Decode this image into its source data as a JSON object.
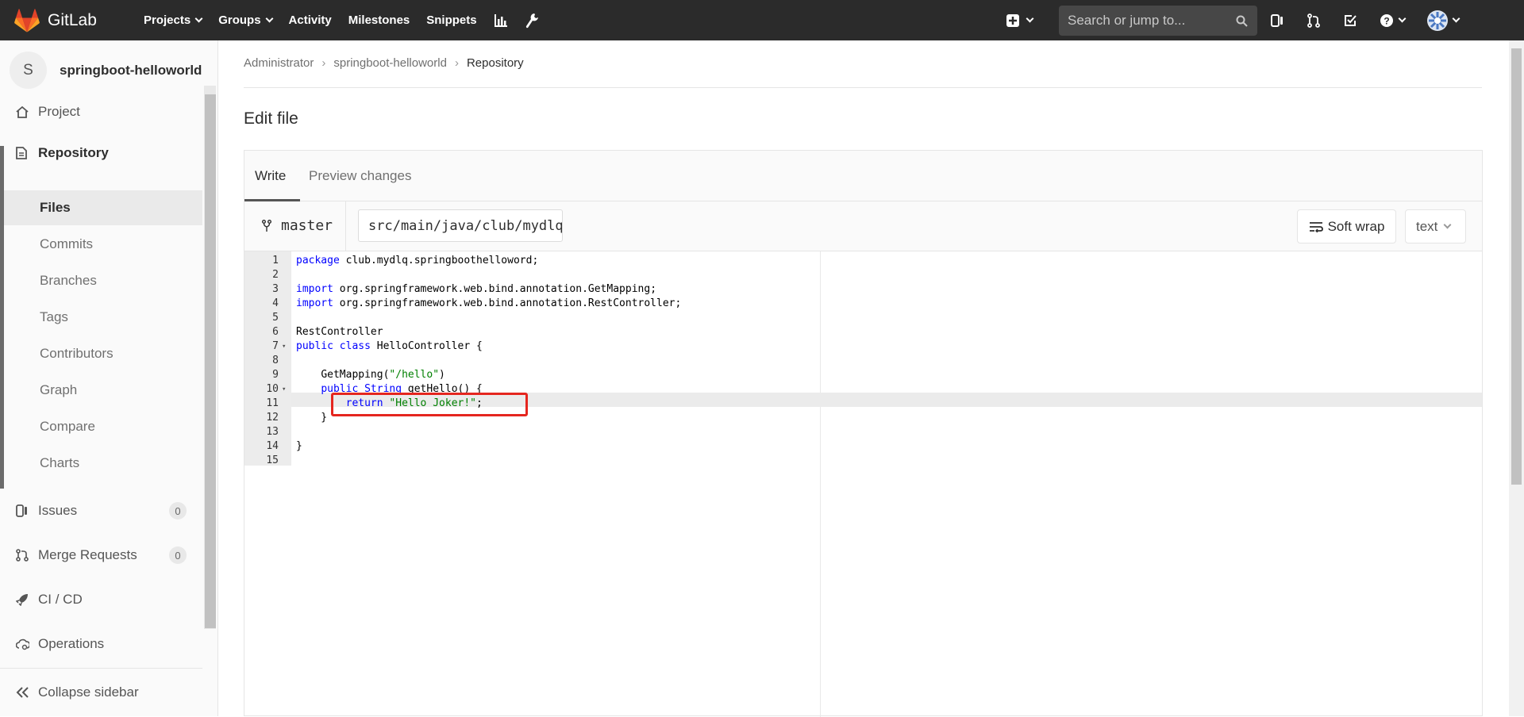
{
  "navbar": {
    "brand": "GitLab",
    "links": [
      {
        "label": "Projects",
        "dropdown": true
      },
      {
        "label": "Groups",
        "dropdown": true
      },
      {
        "label": "Activity",
        "dropdown": false
      },
      {
        "label": "Milestones",
        "dropdown": false
      },
      {
        "label": "Snippets",
        "dropdown": false
      }
    ],
    "search_placeholder": "Search or jump to..."
  },
  "sidebar": {
    "project_avatar": "S",
    "project_name": "springboot-helloworld",
    "items": [
      {
        "label": "Project",
        "icon": "home-icon"
      },
      {
        "label": "Repository",
        "icon": "document-icon"
      },
      {
        "label": "Issues",
        "icon": "issues-icon",
        "count": "0"
      },
      {
        "label": "Merge Requests",
        "icon": "merge-request-icon",
        "count": "0"
      },
      {
        "label": "CI / CD",
        "icon": "rocket-icon"
      },
      {
        "label": "Operations",
        "icon": "cloud-gear-icon"
      }
    ],
    "repository_subitems": [
      "Files",
      "Commits",
      "Branches",
      "Tags",
      "Contributors",
      "Graph",
      "Compare",
      "Charts"
    ],
    "collapse_label": "Collapse sidebar"
  },
  "breadcrumb": {
    "items": [
      "Administrator",
      "springboot-helloworld",
      "Repository"
    ]
  },
  "page": {
    "title": "Edit file"
  },
  "editor": {
    "tabs": [
      "Write",
      "Preview changes"
    ],
    "branch": "master",
    "file_path": "src/main/java/club/mydlq/springboothelloword/HelloController.java",
    "soft_wrap_label": "Soft wrap",
    "language": "text",
    "active_line": 11,
    "highlighted_line": 11,
    "lines": [
      "package club.mydlq.springboothelloword;",
      "",
      "import org.springframework.web.bind.annotation.GetMapping;",
      "import org.springframework.web.bind.annotation.RestController;",
      "",
      "@RestController",
      "public class HelloController {",
      "",
      "    @GetMapping(\"/hello\")",
      "    public String getHello() {",
      "        return \"Hello Joker!\";",
      "    }",
      "",
      "}",
      ""
    ]
  },
  "colors": {
    "navbar_bg": "#2b2b2b",
    "highlight_box": "#e5261f",
    "keyword": "#0000ff",
    "string": "#008000"
  }
}
